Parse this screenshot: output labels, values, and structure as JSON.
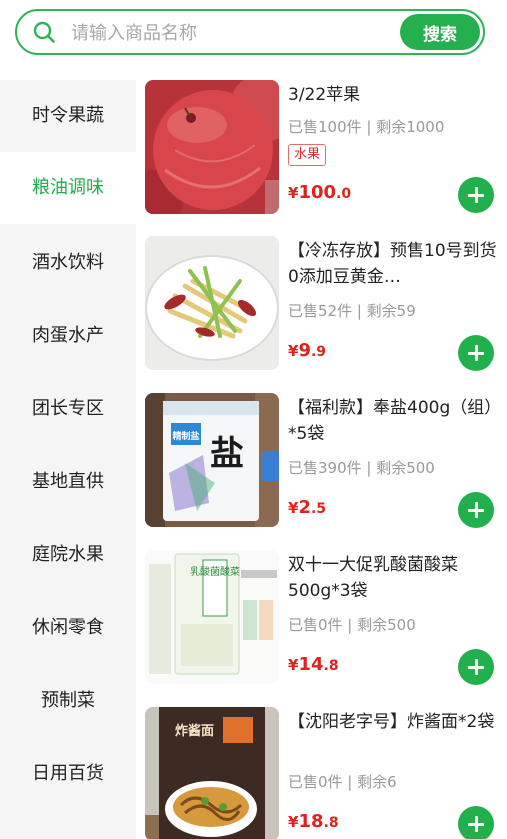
{
  "search": {
    "placeholder": "请输入商品名称",
    "button_label": "搜索"
  },
  "sidebar": {
    "items": [
      {
        "label": "时令果蔬"
      },
      {
        "label": "粮油调味",
        "active": true
      },
      {
        "label": "酒水饮料"
      },
      {
        "label": "肉蛋水产"
      },
      {
        "label": "团长专区"
      },
      {
        "label": "基地直供"
      },
      {
        "label": "庭院水果"
      },
      {
        "label": "休闲零食"
      },
      {
        "label": "预制菜"
      },
      {
        "label": "日用百货"
      }
    ]
  },
  "products": [
    {
      "title": "3/22苹果",
      "stats": "已售100件 | 剩余1000",
      "tag": "水果",
      "price": {
        "currency": "¥",
        "integer": "100",
        "decimal": ".0"
      },
      "image": "apple-photo"
    },
    {
      "title": "【冷冻存放】预售10号到货0添加豆黄金…",
      "stats": "已售52件 | 剩余59",
      "price": {
        "currency": "¥",
        "integer": "9",
        "decimal": ".9"
      },
      "image": "tofu-skin-dish-photo"
    },
    {
      "title": "【福利款】奉盐400g（组）*5袋",
      "stats": "已售390件 | 剩余500",
      "price": {
        "currency": "¥",
        "integer": "2",
        "decimal": ".5"
      },
      "image": "salt-package-photo",
      "image_text": {
        "brand": "精制盐",
        "big": "盐"
      }
    },
    {
      "title": "双十一大促乳酸菌酸菜500g*3袋",
      "stats": "已售0件 | 剩余500",
      "price": {
        "currency": "¥",
        "integer": "14",
        "decimal": ".8"
      },
      "image": "sauerkraut-package-photo",
      "image_text": {
        "label": "乳酸菌酸菜"
      }
    },
    {
      "title": "【沈阳老字号】炸酱面*2袋",
      "stats": "已售0件 | 剩余6",
      "price": {
        "currency": "¥",
        "integer": "18",
        "decimal": ".8"
      },
      "image": "noodle-package-photo",
      "image_text": {
        "label": "炸酱面"
      }
    }
  ],
  "colors": {
    "accent": "#25b04f",
    "price": "#e0221f",
    "sidebar_bg": "#f5f5f5"
  }
}
